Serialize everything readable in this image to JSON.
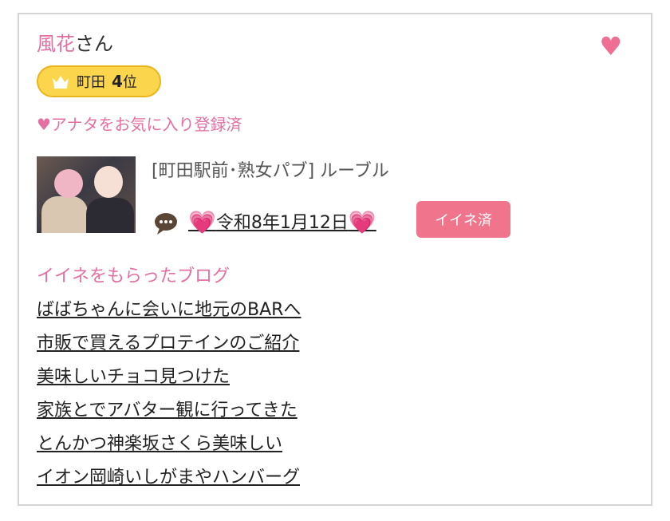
{
  "profile": {
    "name": "風花",
    "name_suffix": "さん",
    "favorite_text": "♥アナタをお気に入り登録済"
  },
  "rank": {
    "area": "町田",
    "number": "4",
    "suffix": "位",
    "badge_color": "#fbd64d"
  },
  "shop": {
    "label": "[町田駅前･熟女パブ]  ルーブル"
  },
  "iine": {
    "heart_left": "💗",
    "date": "令和8年1月12日",
    "heart_right": "💗",
    "button_label": "イイネ済",
    "button_color": "#f0748b"
  },
  "blogs": {
    "title": "イイネをもらったブログ",
    "items": [
      "ばばちゃんに会いに地元のBARへ",
      "市販で買えるプロテインのご紹介",
      "美味しいチョコ見つけた",
      "家族とでアバター観に行ってきた",
      "とんかつ神楽坂さくら美味しい",
      "イオン岡崎いしがまやハンバーグ"
    ]
  },
  "icons": {
    "top_heart": "heart-icon",
    "top_heart_glyph": "♥",
    "crown": "crown-icon",
    "chat": "speech-bubble-icon"
  },
  "colors": {
    "accent_pink": "#e46fa2",
    "heart_pink": "#ef6f93"
  }
}
